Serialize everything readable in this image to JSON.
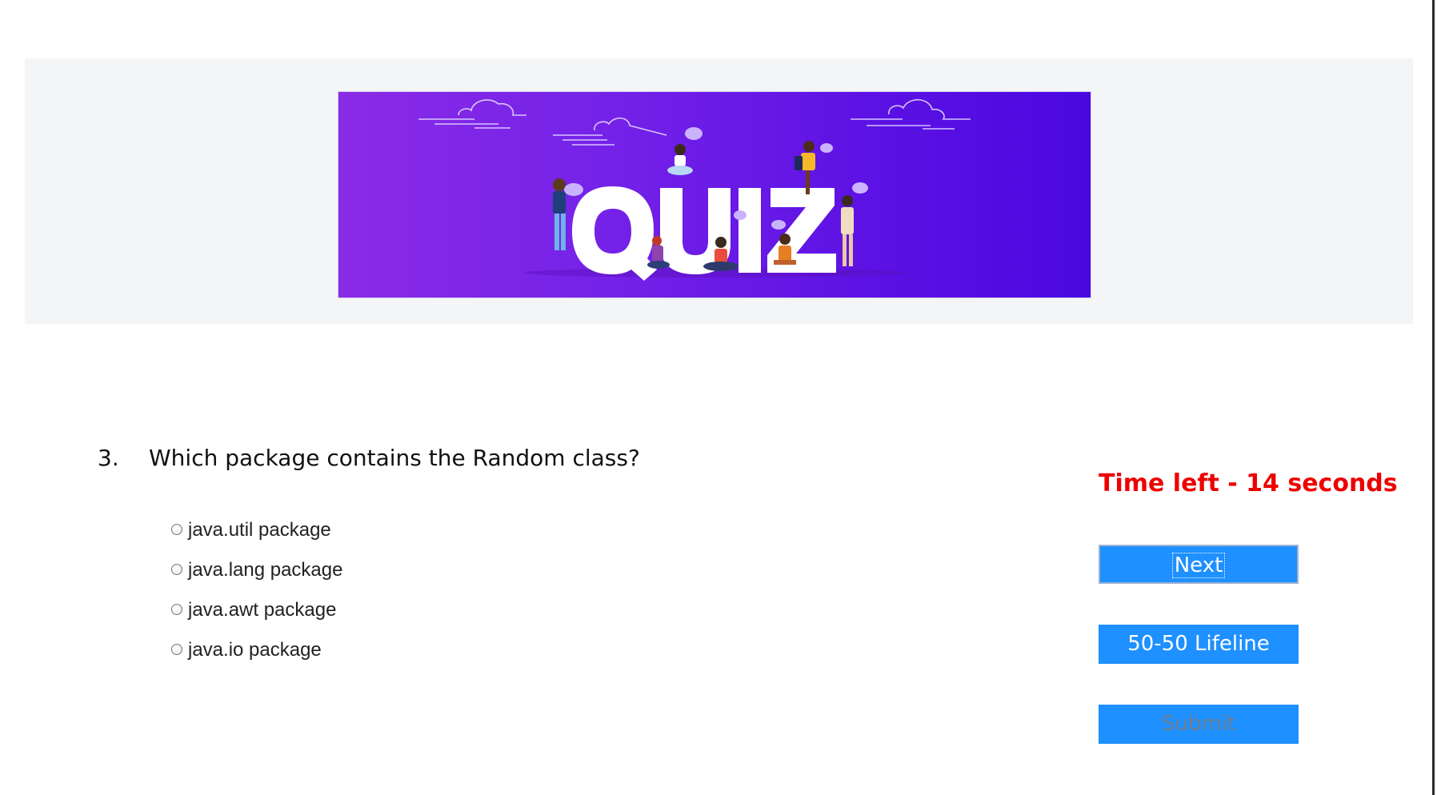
{
  "banner": {
    "title": "QUIZ"
  },
  "question": {
    "number": "3.",
    "text": "Which package contains the Random class?"
  },
  "options": [
    {
      "label": "java.util package",
      "selected": false
    },
    {
      "label": "java.lang package",
      "selected": false
    },
    {
      "label": "java.awt package",
      "selected": false
    },
    {
      "label": "java.io package",
      "selected": false
    }
  ],
  "timer": {
    "text": "Time left - 14 seconds"
  },
  "buttons": {
    "next": "Next",
    "lifeline": "50-50 Lifeline",
    "submit": "Submit"
  },
  "colors": {
    "accent": "#1e90ff",
    "timer": "#ee0000",
    "banner_start": "#8a2be6",
    "banner_end": "#4a08e0",
    "disabled_text": "#6f7f8f"
  }
}
